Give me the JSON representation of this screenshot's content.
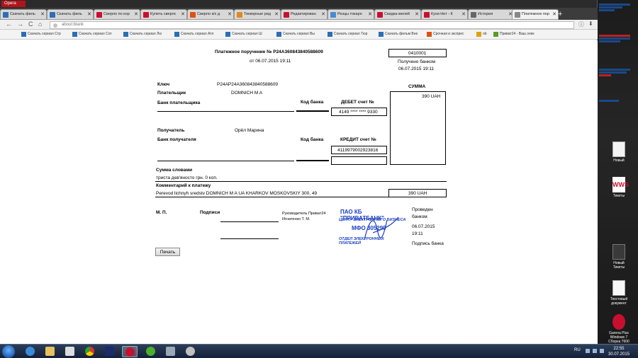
{
  "window_button": "Opera",
  "tabs": [
    {
      "label": "Скачать филь",
      "color": "#2b6fb5"
    },
    {
      "label": "Скачать филь",
      "color": "#2b6fb5"
    },
    {
      "label": "Сверло по кор",
      "color": "#c8102e"
    },
    {
      "label": "Купить сверлс",
      "color": "#c8102e"
    },
    {
      "label": "Сверло к/х д",
      "color": "#e05010"
    },
    {
      "label": "Тиккерные ред",
      "color": "#e08a1e"
    },
    {
      "label": "Редактирован",
      "color": "#c8102e"
    },
    {
      "label": "Резцы токарн",
      "color": "#4a8ad0"
    },
    {
      "label": "Скидка-желей",
      "color": "#c8102e"
    },
    {
      "label": "Кухи Нет - К",
      "color": "#c8102e"
    },
    {
      "label": "История",
      "color": "#666666"
    },
    {
      "label": "Платежное пор",
      "color": "#888888"
    }
  ],
  "address": {
    "url": "about:blank",
    "back": "←",
    "forward": "→",
    "reload": "C",
    "home": "⌂"
  },
  "bookmarks": [
    "Скачать сериал Стр",
    "Скачать сериал Сот",
    "Скачать сериал Лю",
    "Скачать сериал Атл",
    "Скачать сериал Ш",
    "Скачать сериал Вы",
    "Скачать сериал Тюр",
    "Скачать фильм Вне",
    "Срочная и экспрес",
    "ob",
    "Приват24 - Ваш элек"
  ],
  "doc": {
    "title": "Платежное поручение № P24A360843840588609",
    "date": "от 06.07.2015 19:11",
    "code_box": "0410001",
    "received_label": "Получено банком",
    "received_date": "06.07.2015 19:11",
    "key_label": "Ключ",
    "key_value": "P24AP24A360843840588609",
    "payer_label": "Плательщик",
    "payer_value": "DOMNICH M A",
    "payer_bank_label": "Банк плательщика",
    "bank_code_label": "Код банка",
    "debit_label": "ДЕБЕТ счет №",
    "debit_value": "4149 **** **** 9330",
    "sum_label": "СУММА",
    "sum_value": "390 UAH",
    "recipient_label": "Получатель",
    "recipient_value": "Орёл Марина",
    "recipient_bank_label": "Банк получателя",
    "bank_code_label2": "Код банка",
    "credit_label": "КРЕДИТ счет №",
    "credit_value": "4119979002923816",
    "words_label": "Сумма словами",
    "words_value": "триста дев'яносто грн. 0 коп.",
    "comment_label": "Комментарий к платежу",
    "comment_value": "Perevod lichnyh sredstv DOMNICH M A UA KHARKOV MOSKOVSKIY 300, 49",
    "comment_sum": "390 UAH",
    "mp_label": "М. П.",
    "signatures_label": "Подписи",
    "head_label": "Руководитель Приват24",
    "head_name": "Игнатенко Т. М.",
    "conducted_1": "Проведен",
    "conducted_2": "банком",
    "conducted_date": "06.07.2015",
    "conducted_time": "19:11",
    "bank_signature": "Подпись банка",
    "stamp_1": "ПАО КБ \"ПРИВАТБАНК\"",
    "stamp_2": "ЦЕНТР ЭЛЕКТРОННОГО БИЗНЕСА",
    "stamp_3": "МФО 305299",
    "stamp_4": "ОТДЕЛ ЭЛЕКТРОННЫХ ПЛАТЕЖЕЙ",
    "print_button": "Печать"
  },
  "desktop": {
    "icon_1": "Новый",
    "icon_2": "Тикеты",
    "icon_3": "Новый Тикеты",
    "icon_4": "Текстовый документ",
    "icon_5": "Garena Plus",
    "os_label": "Windows 7",
    "build_label": "Сборка 7600"
  },
  "taskbar": {
    "lang": "RU",
    "time": "22:55",
    "date": "30.07.2015"
  }
}
